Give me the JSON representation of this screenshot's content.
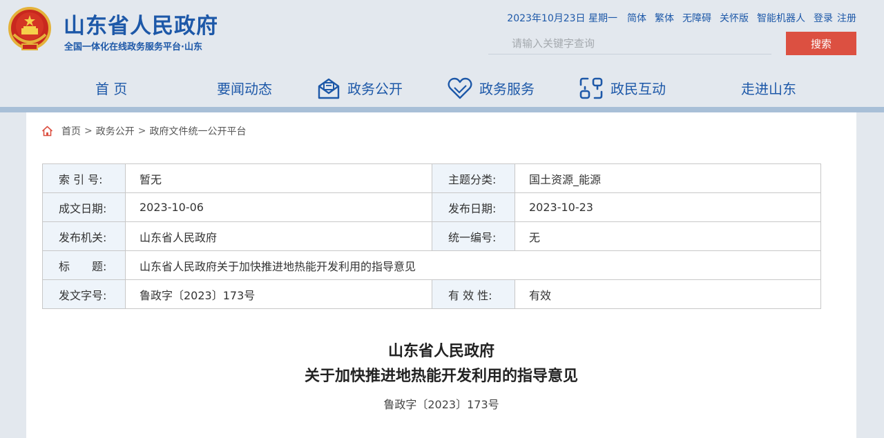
{
  "header": {
    "site_title": "山东省人民政府",
    "site_subtitle": "全国一体化在线政务服务平台·山东",
    "date": "2023年10月23日 星期一",
    "links": [
      "简体",
      "繁体",
      "无障碍",
      "关怀版",
      "智能机器人"
    ],
    "login": "登录",
    "register": "注册",
    "search_placeholder": "请输入关键字查询",
    "search_button": "搜索"
  },
  "nav": {
    "items": [
      "首 页",
      "要闻动态",
      "政务公开",
      "政务服务",
      "政民互动",
      "走进山东"
    ]
  },
  "breadcrumb": {
    "home": "首页",
    "sep": ">",
    "level1": "政务公开",
    "level2": "政府文件统一公开平台"
  },
  "meta": {
    "index_label": "索 引 号:",
    "index_value": "暂无",
    "topic_label": "主题分类:",
    "topic_value": "国土资源_能源",
    "written_label": "成文日期:",
    "written_value": "2023-10-06",
    "published_label": "发布日期:",
    "published_value": "2023-10-23",
    "issuer_label": "发布机关:",
    "issuer_value": "山东省人民政府",
    "unified_label": "统一编号:",
    "unified_value": "无",
    "title_label": "标　　题:",
    "title_value": "山东省人民政府关于加快推进地热能开发利用的指导意见",
    "docno_label": "发文字号:",
    "docno_value": "鲁政字〔2023〕173号",
    "validity_label": "有 效 性:",
    "validity_value": "有效"
  },
  "document": {
    "title_line1": "山东省人民政府",
    "title_line2": "关于加快推进地热能开发利用的指导意见",
    "doc_number": "鲁政字〔2023〕173号"
  },
  "colors": {
    "brand_blue": "#1d58a8",
    "accent_red": "#dc5041",
    "header_bg": "#e3e8ee",
    "label_bg": "#eef4fa"
  },
  "icons": {
    "emblem": "national-emblem",
    "nav_gov_open": "envelope-icon",
    "nav_service": "heart-icon",
    "nav_interact": "interaction-icon",
    "home": "home-icon"
  }
}
